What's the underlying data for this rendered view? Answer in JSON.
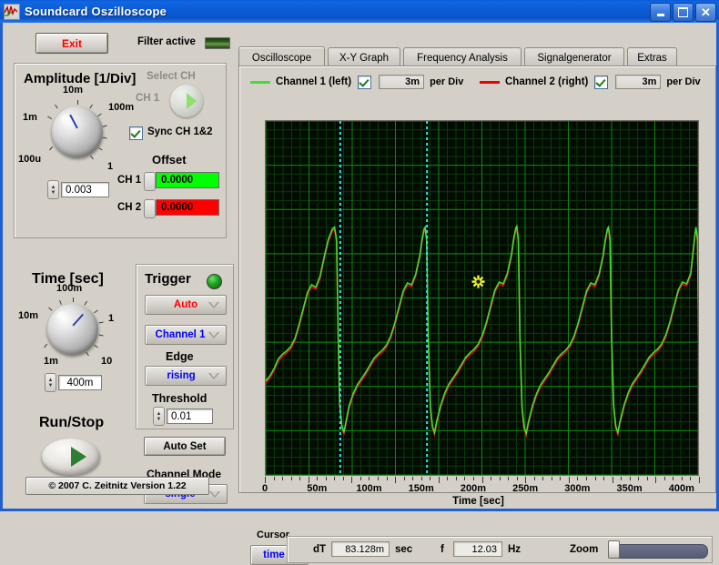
{
  "window": {
    "title": "Soundcard Oszilloscope",
    "icon": "waveform-icon",
    "minimize": "_",
    "maximize": "□",
    "close": "✕"
  },
  "left_panel": {
    "exit_label": "Exit",
    "filter_label": "Filter active",
    "filter_led_state": "on",
    "amplitude": {
      "title": "Amplitude [1/Div]",
      "knob_labels": [
        "10m",
        "100m",
        "1",
        "100u",
        "1m"
      ],
      "value": "0.003",
      "select_ch_label": "Select CH",
      "ch_label": "CH 1",
      "sync_label": "Sync CH 1&2",
      "sync_checked": true,
      "offset_title": "Offset",
      "offset_ch1_label": "CH 1",
      "offset_ch1_value": "0.0000",
      "offset_ch1_color": "#00FF00",
      "offset_ch2_label": "CH 2",
      "offset_ch2_value": "0.0000",
      "offset_ch2_color": "#FF0000"
    },
    "time": {
      "title": "Time [sec]",
      "knob_labels": [
        "100m",
        "1",
        "10",
        "1m",
        "10m"
      ],
      "value": "400m"
    },
    "run_stop": {
      "label": "Run/Stop"
    },
    "trigger": {
      "title": "Trigger",
      "led_state": "on",
      "mode": "Auto",
      "mode_color": "#FF0000",
      "source": "Channel 1",
      "source_color": "#0000FF",
      "edge_label": "Edge",
      "edge": "rising",
      "edge_color": "#0000FF",
      "threshold_label": "Threshold",
      "threshold_value": "0.01",
      "autoset_label": "Auto Set"
    },
    "channel_mode": {
      "label": "Channel Mode",
      "value": "single",
      "value_color": "#0000FF"
    },
    "copyright": "© 2007   C. Zeitnitz Version 1.22"
  },
  "tabs": [
    {
      "label": "Oscilloscope",
      "active": true
    },
    {
      "label": "X-Y Graph",
      "active": false
    },
    {
      "label": "Frequency Analysis",
      "active": false
    },
    {
      "label": "Signalgenerator",
      "active": false
    },
    {
      "label": "Extras",
      "active": false
    }
  ],
  "legend": {
    "ch1": {
      "label": "Channel 1 (left)",
      "color": "#44DD33",
      "checked": true,
      "div_value": "3m",
      "per_div": "per Div"
    },
    "ch2": {
      "label": "Channel 2 (right)",
      "color": "#EE0000",
      "checked": true,
      "div_value": "3m",
      "per_div": "per Div"
    }
  },
  "cursor_bar": {
    "cursor_label": "Cursor",
    "cursor_mode": "time",
    "cursor_mode_color": "#0000FF",
    "dt_label": "dT",
    "dt_value": "83.128m",
    "dt_unit": "sec",
    "f_label": "f",
    "f_value": "12.03",
    "f_unit": "Hz",
    "zoom_label": "Zoom",
    "zoom_percent": 1
  },
  "chart_data": {
    "type": "line",
    "title": "",
    "xlabel": "Time [sec]",
    "ylabel": "",
    "xlim": [
      0,
      0.415
    ],
    "ylim": [
      -1,
      1
    ],
    "xtick_labels": [
      "0",
      "50m",
      "100m",
      "150m",
      "200m",
      "250m",
      "300m",
      "350m",
      "400m"
    ],
    "xtick_values": [
      0,
      0.05,
      0.1,
      0.15,
      0.2,
      0.25,
      0.3,
      0.35,
      0.4
    ],
    "grid": true,
    "grid_major_color": "#0C8A0C",
    "grid_minor_color": "#0A3A0A",
    "background": "#030C03",
    "legend_position": "top",
    "cursors": [
      {
        "name": "cursor-1",
        "x": 0.0715,
        "color": "#2FE8E8",
        "style": "dotted"
      },
      {
        "name": "cursor-2",
        "x": 0.1548,
        "color": "#2FE8E8",
        "style": "dotted"
      }
    ],
    "marker": {
      "name": "cursor-cross",
      "x": 0.204,
      "y": 0.092,
      "color": "#F5F53A"
    },
    "series": [
      {
        "name": "Channel 1 (left)",
        "color": "#44DD33",
        "period": 0.0832,
        "points": [
          [
            0.0,
            -0.47
          ],
          [
            0.004,
            -0.44
          ],
          [
            0.008,
            -0.4
          ],
          [
            0.012,
            -0.345
          ],
          [
            0.016,
            -0.318
          ],
          [
            0.02,
            -0.3
          ],
          [
            0.024,
            -0.275
          ],
          [
            0.028,
            -0.23
          ],
          [
            0.032,
            -0.15
          ],
          [
            0.036,
            -0.06
          ],
          [
            0.04,
            0.03
          ],
          [
            0.044,
            0.075
          ],
          [
            0.048,
            0.06
          ],
          [
            0.052,
            0.12
          ],
          [
            0.056,
            0.23
          ],
          [
            0.06,
            0.33
          ],
          [
            0.064,
            0.39
          ],
          [
            0.066,
            0.4
          ],
          [
            0.068,
            0.33
          ],
          [
            0.0695,
            -0.2
          ],
          [
            0.071,
            -0.6
          ],
          [
            0.073,
            -0.72
          ],
          [
            0.075,
            -0.76
          ],
          [
            0.077,
            -0.7
          ],
          [
            0.08,
            -0.61
          ],
          [
            0.084,
            -0.54
          ],
          [
            0.088,
            -0.49
          ],
          [
            0.092,
            -0.455
          ],
          [
            0.096,
            -0.42
          ],
          [
            0.1,
            -0.38
          ],
          [
            0.104,
            -0.34
          ],
          [
            0.108,
            -0.315
          ],
          [
            0.112,
            -0.295
          ],
          [
            0.116,
            -0.265
          ],
          [
            0.12,
            -0.215
          ],
          [
            0.124,
            -0.14
          ],
          [
            0.128,
            -0.05
          ],
          [
            0.132,
            0.04
          ],
          [
            0.136,
            0.085
          ],
          [
            0.14,
            0.075
          ],
          [
            0.144,
            0.135
          ],
          [
            0.148,
            0.245
          ],
          [
            0.15,
            0.33
          ],
          [
            0.152,
            0.39
          ],
          [
            0.153,
            0.4
          ],
          [
            0.1545,
            0.33
          ],
          [
            0.156,
            -0.22
          ],
          [
            0.158,
            -0.61
          ],
          [
            0.16,
            -0.725
          ],
          [
            0.162,
            -0.76
          ],
          [
            0.164,
            -0.7
          ],
          [
            0.168,
            -0.605
          ],
          [
            0.172,
            -0.535
          ],
          [
            0.176,
            -0.485
          ],
          [
            0.18,
            -0.45
          ],
          [
            0.184,
            -0.415
          ],
          [
            0.188,
            -0.375
          ],
          [
            0.192,
            -0.335
          ],
          [
            0.196,
            -0.31
          ],
          [
            0.2,
            -0.29
          ],
          [
            0.204,
            -0.26
          ],
          [
            0.208,
            -0.21
          ],
          [
            0.212,
            -0.135
          ],
          [
            0.216,
            -0.045
          ],
          [
            0.22,
            0.045
          ],
          [
            0.224,
            0.09
          ],
          [
            0.228,
            0.08
          ],
          [
            0.232,
            0.14
          ],
          [
            0.236,
            0.25
          ],
          [
            0.238,
            0.335
          ],
          [
            0.24,
            0.395
          ],
          [
            0.241,
            0.405
          ],
          [
            0.2425,
            0.33
          ],
          [
            0.244,
            -0.22
          ],
          [
            0.246,
            -0.615
          ],
          [
            0.248,
            -0.73
          ],
          [
            0.25,
            -0.765
          ],
          [
            0.252,
            -0.705
          ],
          [
            0.256,
            -0.61
          ],
          [
            0.26,
            -0.54
          ],
          [
            0.264,
            -0.49
          ],
          [
            0.268,
            -0.455
          ],
          [
            0.272,
            -0.42
          ],
          [
            0.276,
            -0.38
          ],
          [
            0.28,
            -0.34
          ],
          [
            0.284,
            -0.315
          ],
          [
            0.288,
            -0.295
          ],
          [
            0.292,
            -0.265
          ],
          [
            0.296,
            -0.215
          ],
          [
            0.3,
            -0.14
          ],
          [
            0.304,
            -0.05
          ],
          [
            0.308,
            0.04
          ],
          [
            0.312,
            0.085
          ],
          [
            0.316,
            0.075
          ],
          [
            0.32,
            0.135
          ],
          [
            0.324,
            0.245
          ],
          [
            0.326,
            0.33
          ],
          [
            0.328,
            0.39
          ],
          [
            0.329,
            0.4
          ],
          [
            0.3305,
            0.33
          ],
          [
            0.332,
            -0.22
          ],
          [
            0.334,
            -0.61
          ],
          [
            0.336,
            -0.725
          ],
          [
            0.338,
            -0.76
          ],
          [
            0.34,
            -0.7
          ],
          [
            0.344,
            -0.605
          ],
          [
            0.348,
            -0.535
          ],
          [
            0.352,
            -0.485
          ],
          [
            0.356,
            -0.45
          ],
          [
            0.36,
            -0.415
          ],
          [
            0.364,
            -0.375
          ],
          [
            0.368,
            -0.335
          ],
          [
            0.372,
            -0.31
          ],
          [
            0.376,
            -0.29
          ],
          [
            0.38,
            -0.26
          ],
          [
            0.384,
            -0.21
          ],
          [
            0.388,
            -0.135
          ],
          [
            0.392,
            -0.045
          ],
          [
            0.396,
            0.045
          ],
          [
            0.4,
            0.09
          ],
          [
            0.404,
            0.08
          ],
          [
            0.408,
            0.14
          ],
          [
            0.41,
            0.25
          ],
          [
            0.412,
            0.36
          ],
          [
            0.413,
            0.4
          ],
          [
            0.4145,
            0.33
          ],
          [
            0.4155,
            -0.2
          ],
          [
            0.4165,
            -0.56
          ]
        ]
      },
      {
        "name": "Channel 2 (right)",
        "color": "#EE0000",
        "note": "overlaps Channel 1 almost exactly; visible as red fringe",
        "offset_y": -0.012
      }
    ]
  }
}
